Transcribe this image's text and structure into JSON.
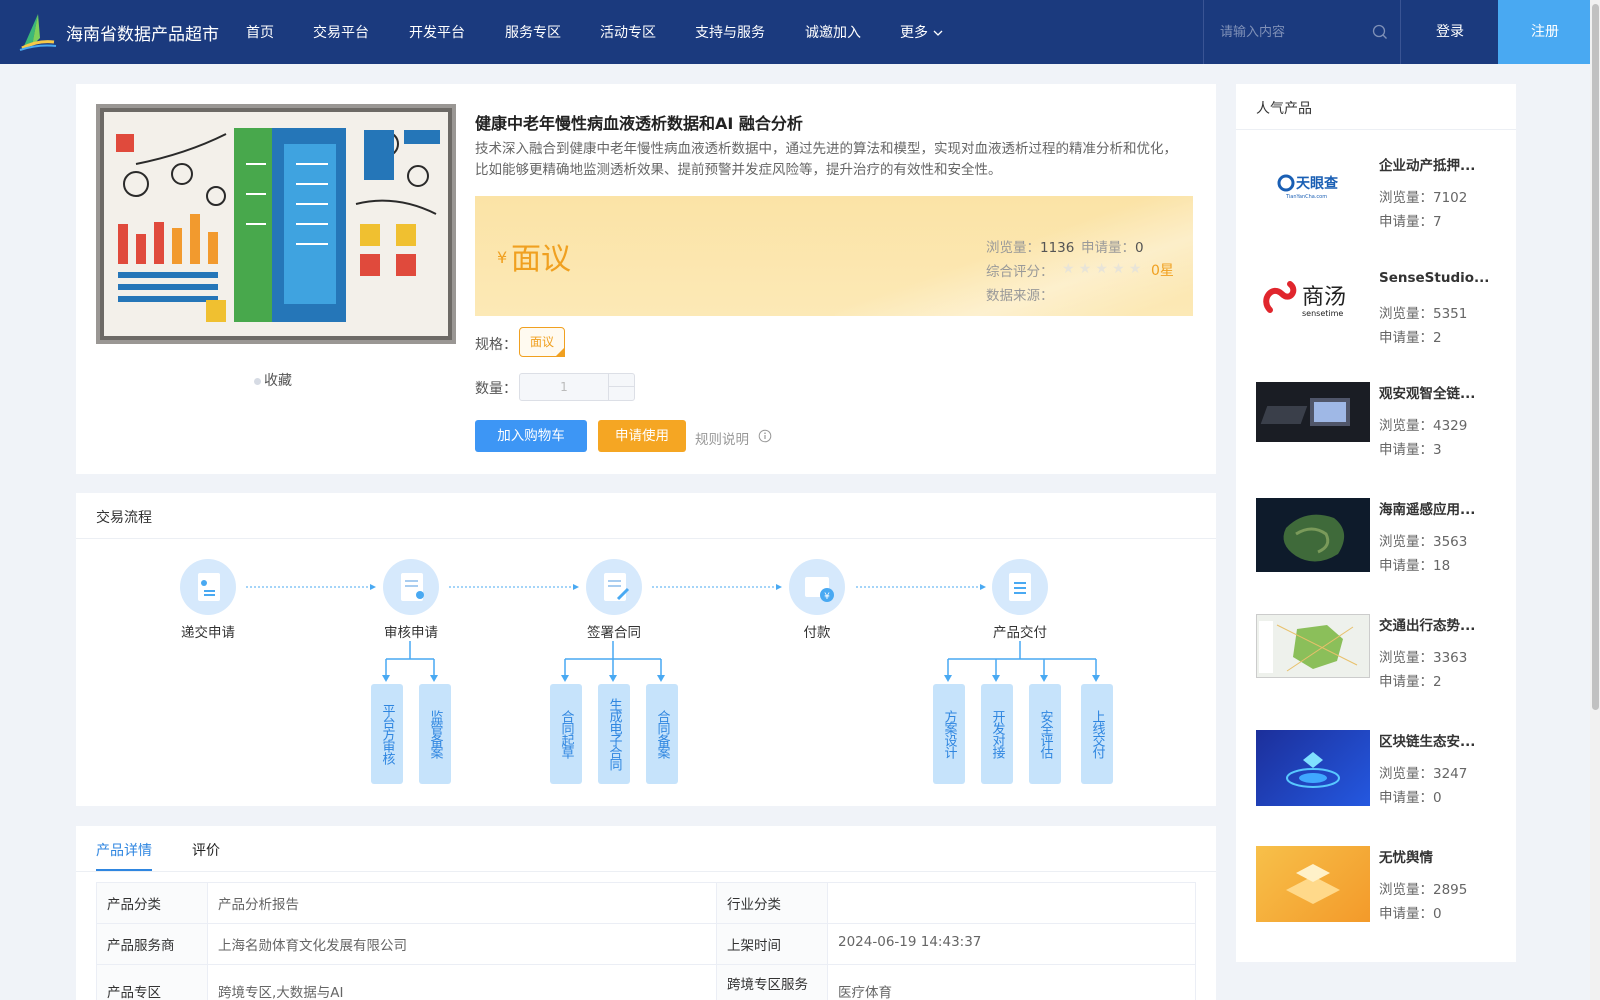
{
  "header": {
    "site_title": "海南省数据产品超市",
    "nav": [
      "首页",
      "交易平台",
      "开发平台",
      "服务专区",
      "活动专区",
      "支持与服务",
      "诚邀加入",
      "更多"
    ],
    "search_placeholder": "请输入内容",
    "login": "登录",
    "register": "注册",
    "colors": {
      "bar": "#1b3a7e",
      "register": "#49a9f2"
    }
  },
  "product": {
    "title": "健康中老年慢性病血液透析数据和AI 融合分析",
    "description": "技术深入融合到健康中老年慢性病血液透析数据中，通过先进的算法和模型，实现对血液透析过程的精准分析和优化，比如能够更精确地监测透析效果、提前预警并发症风险等，提升治疗的有效性和安全性。",
    "favorite": "收藏",
    "price_symbol": "¥",
    "price": "面议",
    "views_label": "浏览量：",
    "views": "1136",
    "applies_label": "申请量：",
    "applies": "0",
    "rating_label": "综合评分：",
    "rating": "0星",
    "stars": [
      "★",
      "★",
      "★",
      "★",
      "★"
    ],
    "source_label": "数据来源：",
    "spec_label": "规格：",
    "spec_value": "面议",
    "qty_label": "数量：",
    "qty_value": "1",
    "add_cart": "加入购物车",
    "apply": "申请使用",
    "rules": "规则说明",
    "accent": "#f0a020"
  },
  "flow": {
    "title": "交易流程",
    "steps": [
      "递交申请",
      "审核申请",
      "签署合同",
      "付款",
      "产品交付"
    ],
    "review_sub": [
      "平台方审核",
      "监管备案"
    ],
    "contract_sub": [
      "合同起草",
      "生成电子合同",
      "合同备案"
    ],
    "delivery_sub": [
      "方案设计",
      "开发对接",
      "安全评估",
      "上线交付"
    ]
  },
  "details": {
    "tabs": [
      "产品详情",
      "评价"
    ],
    "rows": [
      {
        "k1": "产品分类",
        "v1": "产品分析报告",
        "k2": "行业分类",
        "v2": ""
      },
      {
        "k1": "产品服务商",
        "v1": "上海名勋体育文化发展有限公司",
        "k2": "上架时间",
        "v2": "2024-06-19 14:43:37"
      },
      {
        "k1": "产品专区",
        "v1": "跨境专区,大数据与AI",
        "k2": "跨境专区服务",
        "v2": "医疗体育"
      }
    ]
  },
  "popular": {
    "title": "人气产品",
    "views_label": "浏览量：",
    "applies_label": "申请量：",
    "items": [
      {
        "name": "企业动产抵押...",
        "views": "7102",
        "applies": "7",
        "thumb": "tianyancha"
      },
      {
        "name": "SenseStudio...",
        "views": "5351",
        "applies": "2",
        "thumb": "sensetime"
      },
      {
        "name": "观安观智全链...",
        "views": "4329",
        "applies": "3",
        "thumb": "devices"
      },
      {
        "name": "海南遥感应用...",
        "views": "3563",
        "applies": "18",
        "thumb": "satellite"
      },
      {
        "name": "交通出行态势...",
        "views": "3363",
        "applies": "2",
        "thumb": "map"
      },
      {
        "name": "区块链生态安...",
        "views": "3247",
        "applies": "0",
        "thumb": "blockchain"
      },
      {
        "name": "无忧舆情",
        "views": "2895",
        "applies": "0",
        "thumb": "opinion"
      }
    ],
    "logo_text": {
      "tianyancha": "天眼查",
      "tianyancha_sub": "TianYanCha.com",
      "sensetime": "商汤",
      "sensetime_sub": "sensetime"
    }
  }
}
